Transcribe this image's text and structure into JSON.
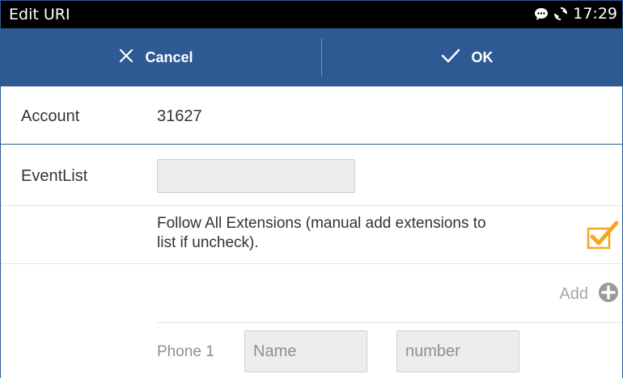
{
  "statusbar": {
    "title": "Edit URI",
    "time": "17:29",
    "icons": [
      "chat-bubble-icon",
      "sync-icon"
    ]
  },
  "actionbar": {
    "cancel_label": "Cancel",
    "ok_label": "OK",
    "color": "#2d5a93"
  },
  "account": {
    "label": "Account",
    "value": "31627"
  },
  "eventlist": {
    "label": "EventList",
    "value": ""
  },
  "follow": {
    "text": "Follow All Extensions (manual add extensions to list if uncheck).",
    "checked": true,
    "check_color": "#f5a623"
  },
  "add": {
    "label": "Add"
  },
  "phone": {
    "label": "Phone 1",
    "name_placeholder": "Name",
    "number_placeholder": "number"
  }
}
